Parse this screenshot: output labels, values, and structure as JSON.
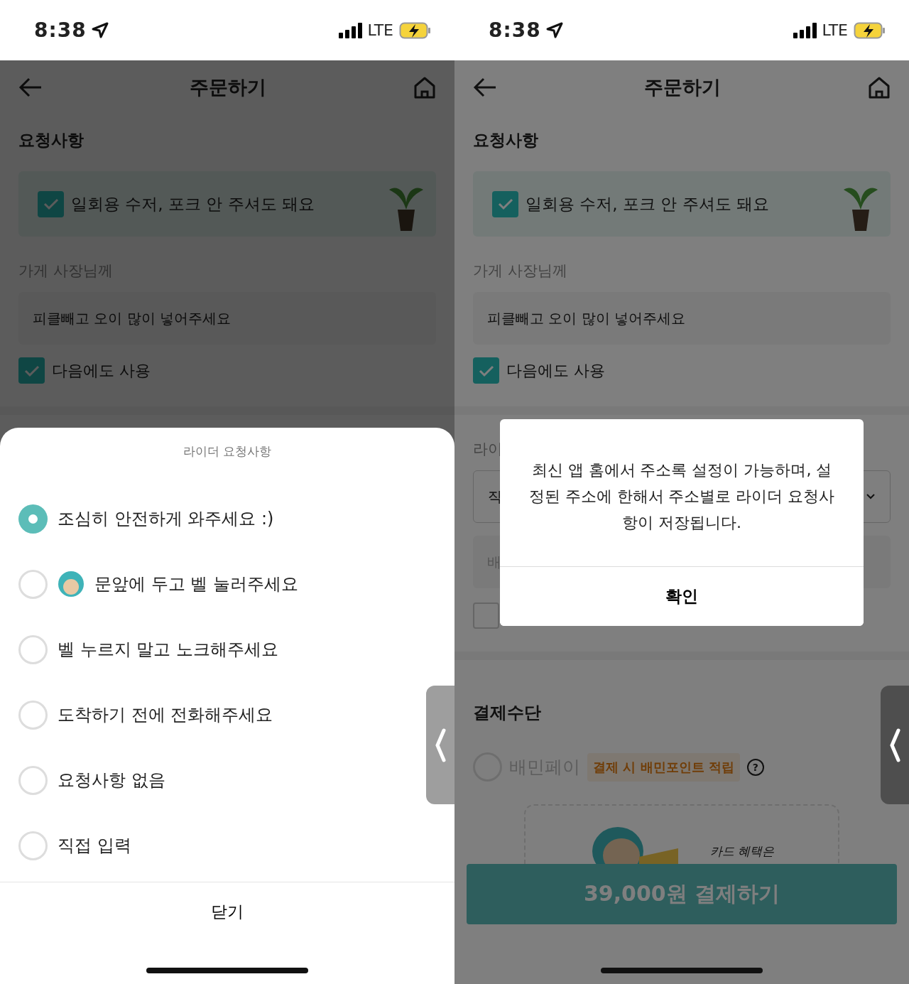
{
  "screens": [
    {
      "kind": "sheet",
      "time": "8:38",
      "network": "LTE",
      "title": "주문하기",
      "section_title": "요청사항",
      "eco_option": {
        "label": "일회용 수저, 포크 안 주셔도 돼요",
        "checked": true
      },
      "store_label": "가게 사장님께",
      "store_request": "피클빼고 오이 많이 넣어주세요",
      "reuse": {
        "label": "다음에도 사용",
        "checked": true
      },
      "sheet": {
        "title": "라이더 요청사항",
        "options": [
          {
            "label": "조심히 안전하게 와주세요 :)",
            "selected": true,
            "kind": "plain"
          },
          {
            "label": "문앞에 두고 벨 눌러주세요",
            "selected": false,
            "kind": "with-icon"
          },
          {
            "label": "벨 누르지 말고 노크해주세요",
            "selected": false,
            "kind": "plain"
          },
          {
            "label": "도착하기 전에 전화해주세요",
            "selected": false,
            "kind": "plain"
          },
          {
            "label": "요청사항 없음",
            "selected": false,
            "kind": "plain"
          },
          {
            "label": "직접 입력",
            "selected": false,
            "kind": "plain"
          }
        ],
        "close": "닫기"
      }
    },
    {
      "kind": "dialog",
      "time": "8:38",
      "network": "LTE",
      "title": "주문하기",
      "section_title": "요청사항",
      "eco_option": {
        "label": "일회용 수저, 포크 안 주셔도 돼요",
        "checked": true
      },
      "store_label": "가게 사장님께",
      "store_request": "피클빼고 오이 많이 넣어주세요",
      "reuse": {
        "label": "다음에도 사용",
        "checked": true
      },
      "rider": {
        "label": "라이",
        "select_value": "직",
        "field_placeholder": "배",
        "checked": false
      },
      "payment": {
        "title": "결제수단",
        "method": {
          "label": "배민페이",
          "selected": false
        },
        "badge": "결제 시 배민포인트 적립",
        "help": "?",
        "banner_text": "카드 혜택은"
      },
      "pay_button": "39,000원 결제하기",
      "dialog": {
        "message": "최신 앱 홈에서 주소록 설정이 가능하며, 설정된 주소에 한해서 주소별로 라이더 요청사항이 저장됩니다.",
        "confirm": "확인"
      }
    }
  ]
}
